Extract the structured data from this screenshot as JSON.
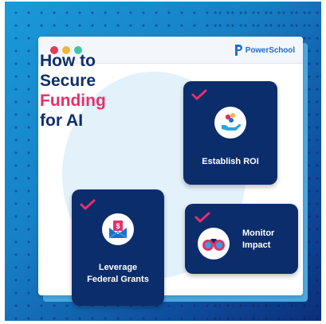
{
  "brand": {
    "name": "PowerSchool",
    "color": "#1d6fd0"
  },
  "headline": {
    "line1": "How to",
    "line2": "Secure",
    "line3": "Funding",
    "line4": "for AI"
  },
  "cards": {
    "roi": {
      "label": "Establish ROI",
      "icon": "hand-with-coins-icon"
    },
    "grants": {
      "label_line1": "Leverage",
      "label_line2": "Federal Grants",
      "icon": "envelope-dollar-icon"
    },
    "impact": {
      "label_line1": "Monitor",
      "label_line2": "Impact",
      "icon": "binoculars-icon"
    }
  },
  "colors": {
    "navy": "#0c2d6b",
    "accent_pink": "#e4306a",
    "heading": "#0f2f6b",
    "bg_blue": "#1680c6"
  }
}
